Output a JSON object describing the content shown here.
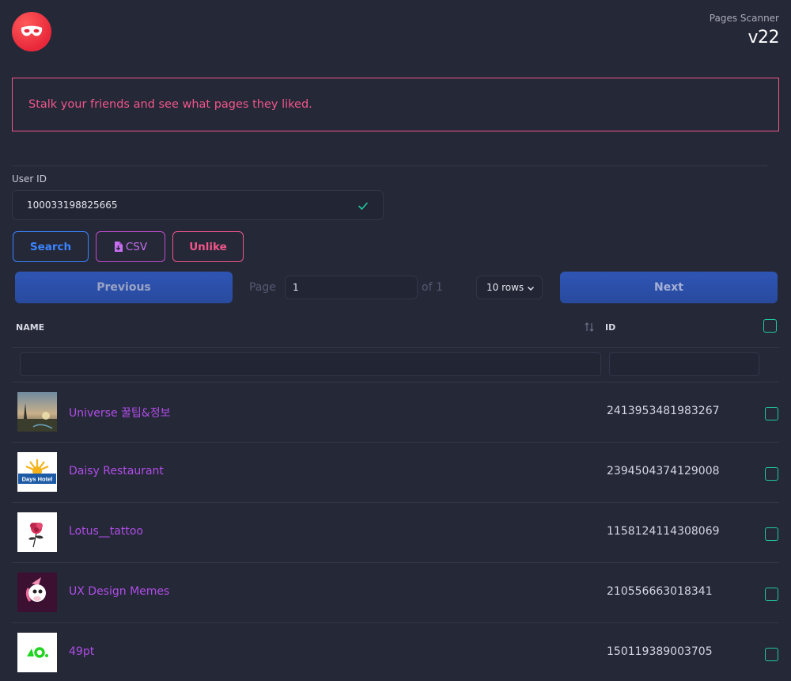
{
  "app": {
    "name": "Pages Scanner",
    "version": "v22",
    "logo_icon": "mask-icon",
    "accent": "#f0568a"
  },
  "banner": {
    "text": "Stalk your friends and see what pages they liked."
  },
  "form": {
    "user_id_label": "User ID",
    "user_id_value": "100033198825665"
  },
  "buttons": {
    "search": "Search",
    "csv": "CSV",
    "unlike": "Unlike"
  },
  "pagination": {
    "previous": "Previous",
    "next": "Next",
    "page_label": "Page",
    "page_value": "1",
    "of_label": "of 1",
    "rows_selected": "10 rows"
  },
  "table": {
    "headers": {
      "name": "NAME",
      "id": "ID"
    },
    "rows": [
      {
        "name": "Universe 꿀팁&정보",
        "id": "2413953481983267",
        "thumb": "sunset-photo"
      },
      {
        "name": "Daisy Restaurant",
        "id": "2394504374129008",
        "thumb": "days-hotel-logo",
        "thumb_text": "Days Hotel"
      },
      {
        "name": "Lotus__tattoo",
        "id": "1158124114308069",
        "thumb": "flower-tattoo-logo"
      },
      {
        "name": "UX Design Memes",
        "id": "210556663018341",
        "thumb": "unicorn-logo"
      },
      {
        "name": "49pt",
        "id": "150119389003705",
        "thumb": "49pt-logo"
      }
    ]
  }
}
